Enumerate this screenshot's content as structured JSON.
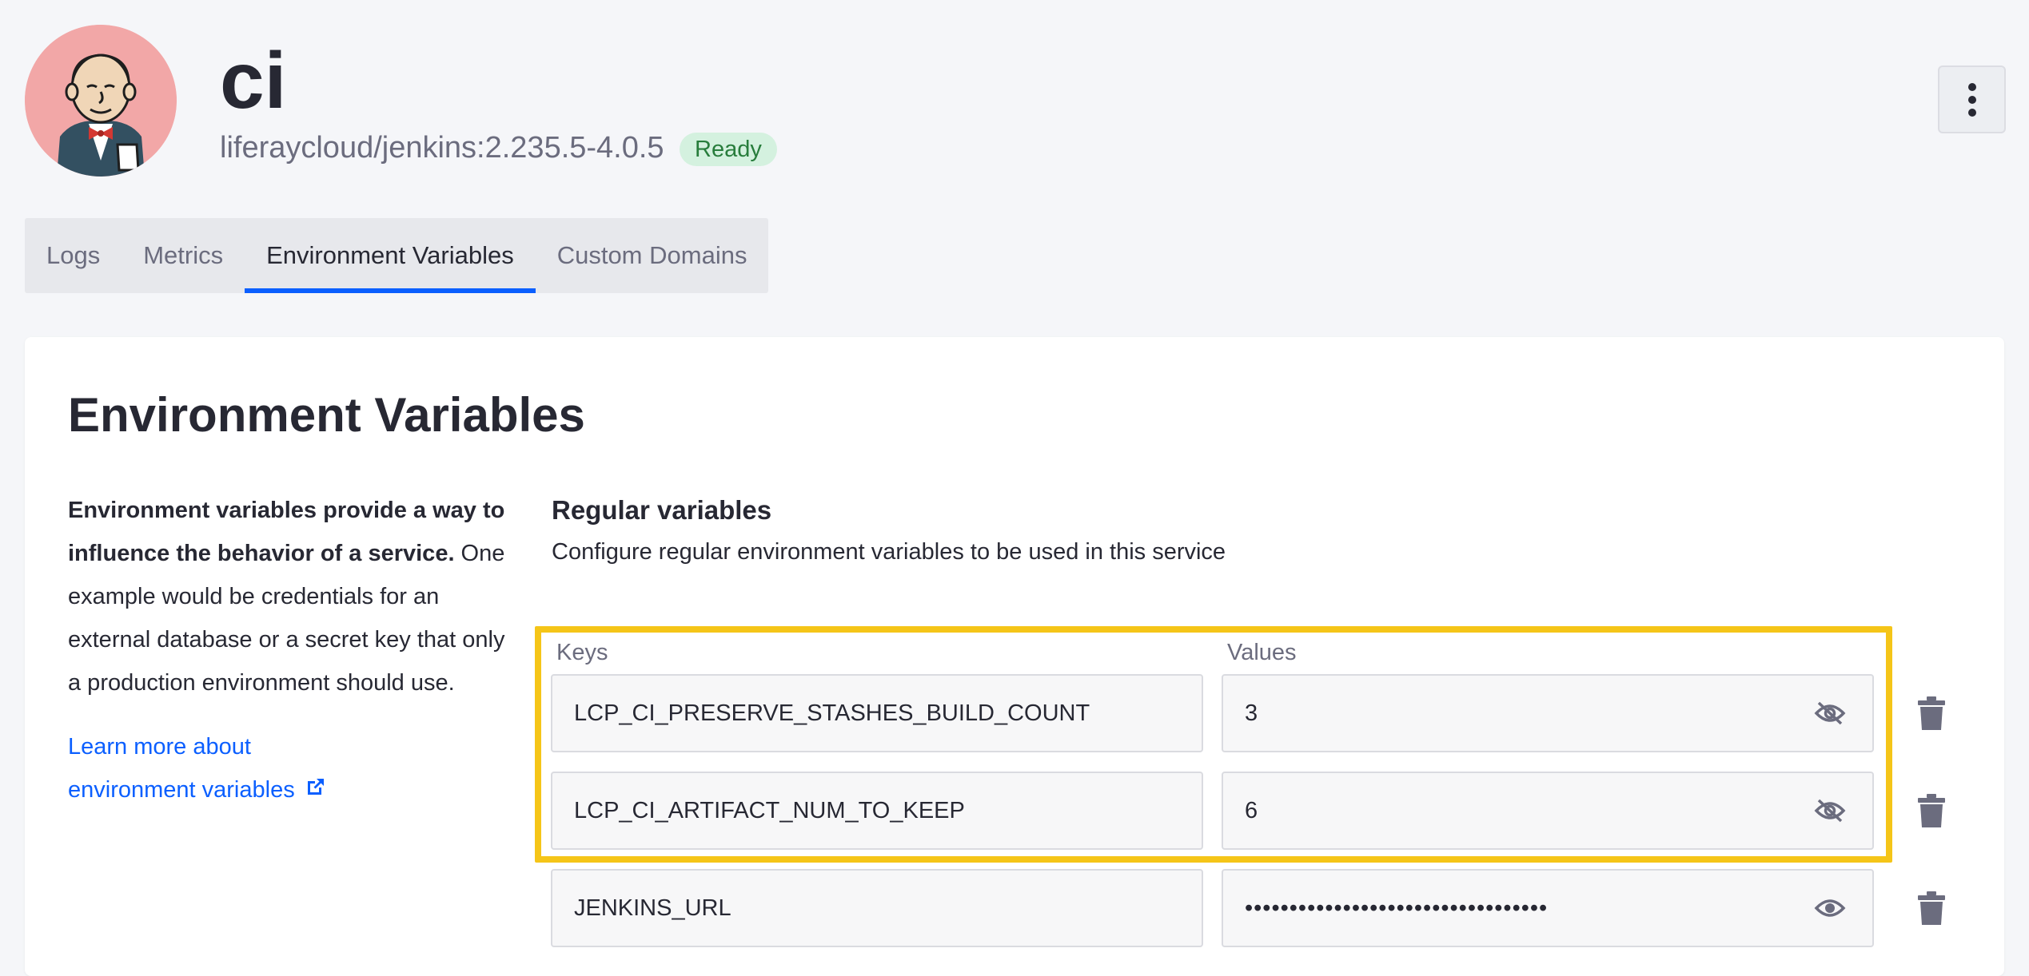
{
  "service": {
    "name": "ci",
    "image": "liferaycloud/jenkins:2.235.5-4.0.5",
    "status": "Ready",
    "avatar_icon": "jenkins-butler-logo",
    "menu_icon": "vertical-ellipsis-icon"
  },
  "tabs": [
    {
      "label": "Logs",
      "active": false
    },
    {
      "label": "Metrics",
      "active": false
    },
    {
      "label": "Environment Variables",
      "active": true
    },
    {
      "label": "Custom Domains",
      "active": false
    }
  ],
  "card": {
    "title": "Environment Variables",
    "description_bold": "Environment variables provide a way to influence the behavior of a service.",
    "description_rest": " One example would be credentials for an external database or a secret key that only a production environment should use.",
    "learn_more_line1": "Learn more about",
    "learn_more_line2": "environment variables"
  },
  "regular": {
    "title": "Regular variables",
    "subtitle": "Configure regular environment variables to be used in this service",
    "keys_label": "Keys",
    "values_label": "Values",
    "rows": [
      {
        "key": "LCP_CI_PRESERVE_STASHES_BUILD_COUNT",
        "value": "3",
        "visibility_icon": "eye-slash-icon"
      },
      {
        "key": "LCP_CI_ARTIFACT_NUM_TO_KEEP",
        "value": "6",
        "visibility_icon": "eye-slash-icon"
      },
      {
        "key": "JENKINS_URL",
        "value": "••••••••••••••••••••••••••••••••••",
        "visibility_icon": "eye-icon"
      }
    ]
  },
  "colors": {
    "accent": "#0b5fff",
    "highlight": "#f5c518",
    "badge_bg": "#d4f1df",
    "badge_text": "#287d3c"
  }
}
